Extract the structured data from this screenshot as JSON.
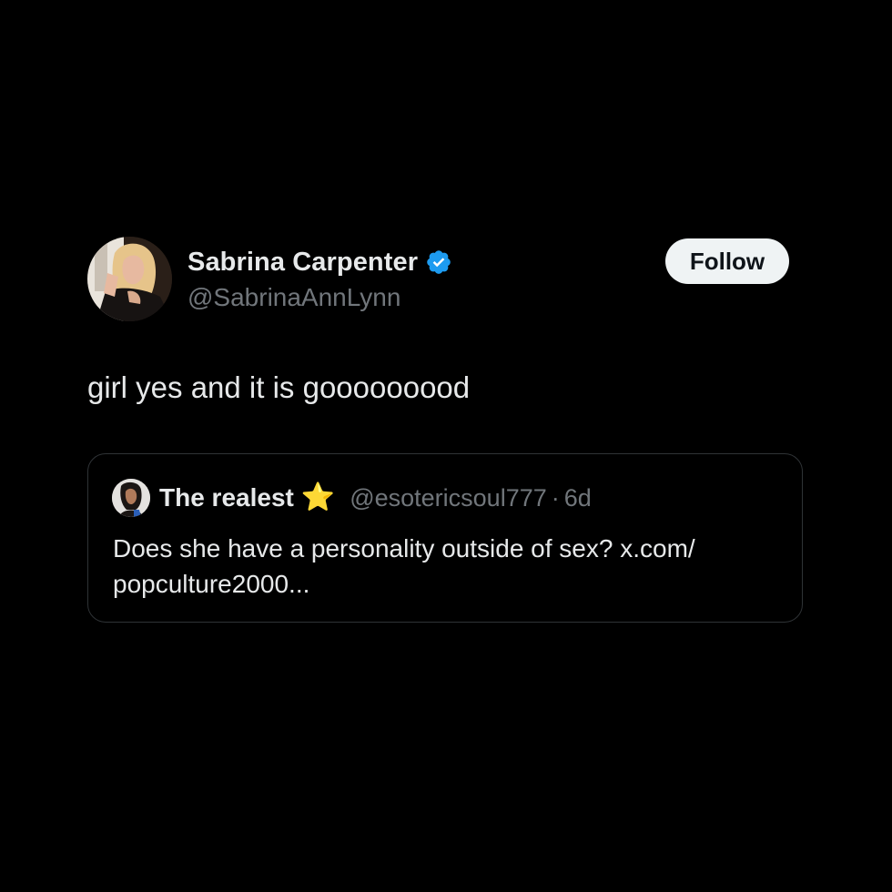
{
  "tweet": {
    "author": {
      "display_name": "Sabrina Carpenter",
      "handle": "@SabrinaAnnLynn",
      "verified": true
    },
    "follow_label": "Follow",
    "text": "girl yes and it is gooooooood"
  },
  "quoted_tweet": {
    "author": {
      "display_name": "The realest",
      "emoji": "⭐",
      "handle": "@esotericsoul777"
    },
    "separator": "·",
    "time": "6d",
    "text": "Does she have a personality outside of sex? x.com/ popculture2000..."
  },
  "colors": {
    "background": "#000000",
    "primary_text": "#e7e9ea",
    "secondary_text": "#71767b",
    "verified_badge": "#1d9bf0",
    "follow_button_bg": "#eff3f4",
    "border": "#2f3336"
  }
}
